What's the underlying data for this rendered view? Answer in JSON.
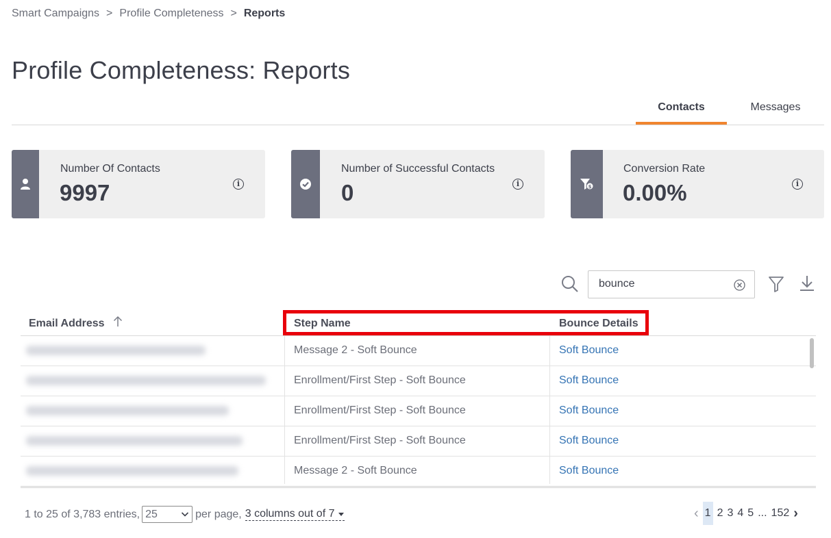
{
  "breadcrumb": {
    "items": [
      "Smart Campaigns",
      "Profile Completeness"
    ],
    "separator": ">",
    "current": "Reports"
  },
  "page_title": "Profile Completeness: Reports",
  "tabs": [
    {
      "label": "Contacts",
      "active": true
    },
    {
      "label": "Messages",
      "active": false
    }
  ],
  "stats": [
    {
      "label": "Number Of Contacts",
      "value": "9997",
      "icon": "user-icon"
    },
    {
      "label": "Number of Successful Contacts",
      "value": "0",
      "icon": "check-circle-icon"
    },
    {
      "label": "Conversion Rate",
      "value": "0.00%",
      "icon": "funnel-dollar-icon"
    }
  ],
  "search": {
    "value": "bounce"
  },
  "table": {
    "headers": [
      "Email Address",
      "Step Name",
      "Bounce Details"
    ],
    "rows": [
      {
        "step": "Message 2 - Soft Bounce",
        "bounce": "Soft Bounce"
      },
      {
        "step": "Enrollment/First Step - Soft Bounce",
        "bounce": "Soft Bounce"
      },
      {
        "step": "Enrollment/First Step - Soft Bounce",
        "bounce": "Soft Bounce"
      },
      {
        "step": "Enrollment/First Step - Soft Bounce",
        "bounce": "Soft Bounce"
      },
      {
        "step": "Message 2 - Soft Bounce",
        "bounce": "Soft Bounce"
      }
    ]
  },
  "footer": {
    "entries_text": "1 to 25 of 3,783 entries,",
    "per_page_value": "25",
    "per_page_text": "per page,",
    "columns_text": "3 columns out of 7"
  },
  "pagination": {
    "prev": "‹",
    "pages": [
      "1",
      "2",
      "3",
      "4",
      "5"
    ],
    "ellipsis": "...",
    "last": "152",
    "next": "›",
    "active": "1"
  },
  "colors": {
    "accent": "#f0852f",
    "link": "#3574b4",
    "highlight": "#e8000b",
    "card_strip": "#6c6f7e"
  }
}
